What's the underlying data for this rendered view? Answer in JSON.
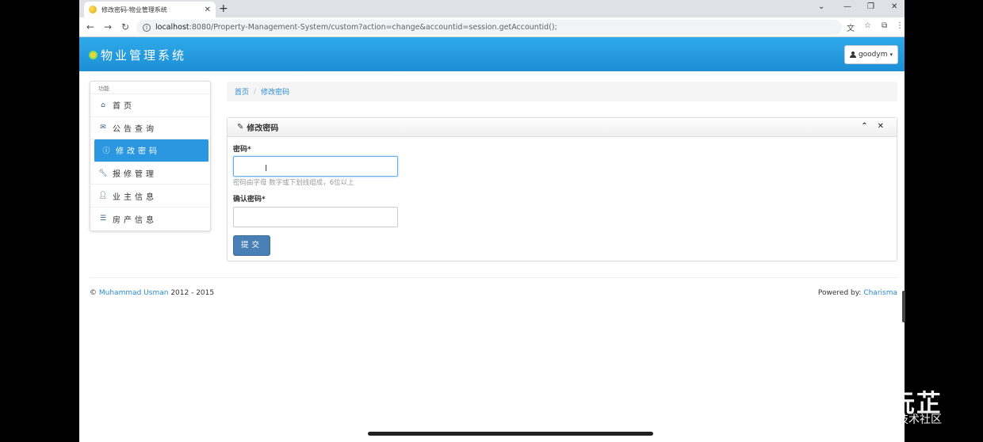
{
  "browser": {
    "tab_title": "修改密码-物业管理系统",
    "url_host": "localhost",
    "url_rest": ":8080/Property-Management-System/custom?action=change&accountid=session.getAccountid();"
  },
  "app": {
    "brand": "物业管理系统",
    "user": "goodym"
  },
  "sidebar": {
    "header": "功能",
    "items": [
      {
        "label": "首页",
        "icon": "home-icon"
      },
      {
        "label": "公告查询",
        "icon": "envelope-icon"
      },
      {
        "label": "修改密码",
        "icon": "info-icon",
        "active": true
      },
      {
        "label": "报修管理",
        "icon": "wrench-icon"
      },
      {
        "label": "业主信息",
        "icon": "user-icon"
      },
      {
        "label": "房产信息",
        "icon": "list-icon"
      }
    ]
  },
  "breadcrumb": [
    "首页",
    "修改密码"
  ],
  "panel": {
    "title": "修改密码",
    "password_label": "密码*",
    "password_help": "密码由字母 数字或下划线组成，6位以上",
    "confirm_label": "确认密码*",
    "submit": "提交"
  },
  "footer": {
    "copyright_symbol": "©",
    "author": "Muhammad Usman",
    "years": "2012 - 2015",
    "powered_prefix": "Powered by:",
    "powered_link": "Charisma"
  },
  "watermark": {
    "big": "知乎 @小沅芷",
    "small": "@稀土掘金技术社区"
  },
  "colors": {
    "header_blue": "#1c8fd6",
    "active_blue": "#2b97e0",
    "button_blue": "#4a7fb5"
  }
}
